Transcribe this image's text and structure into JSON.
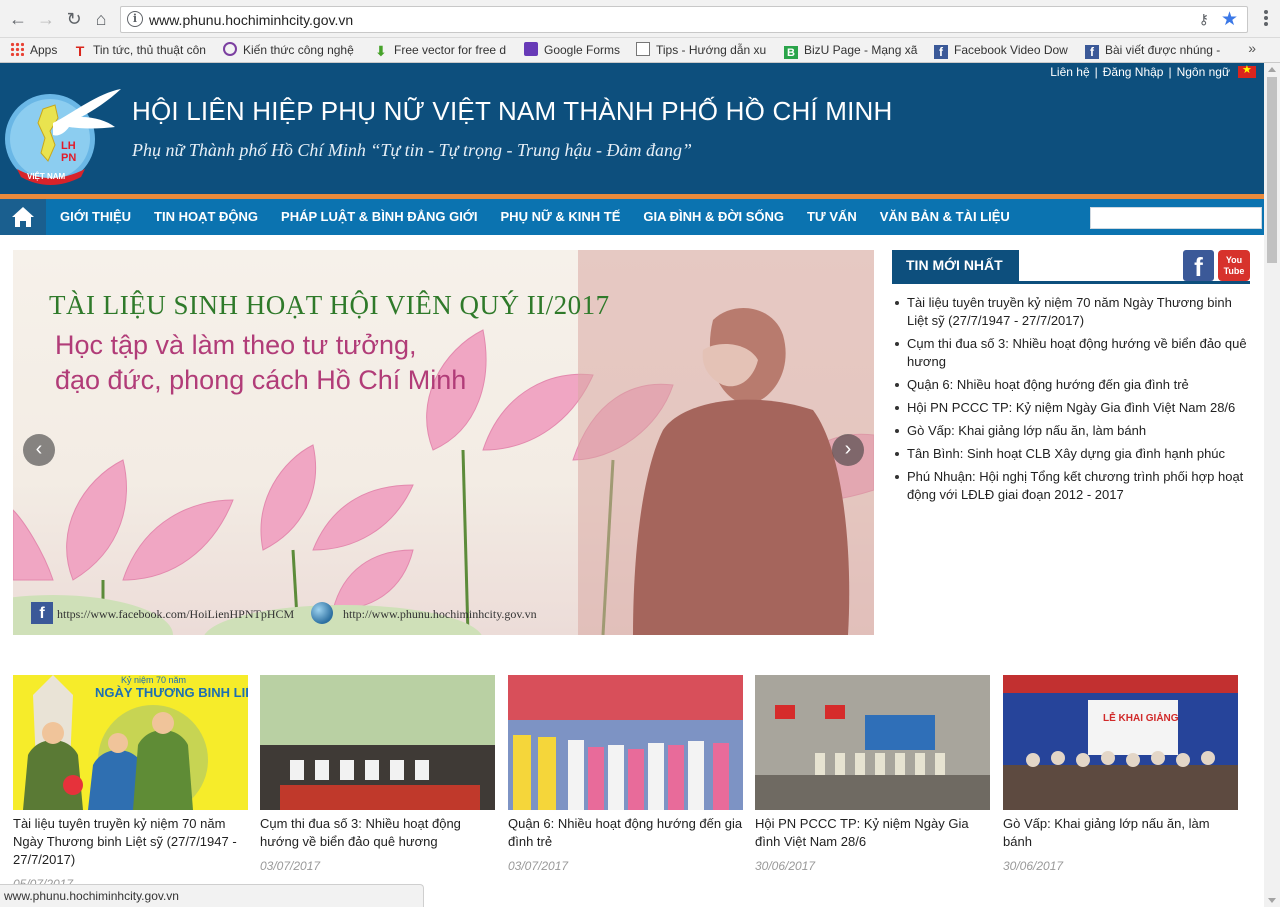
{
  "browser": {
    "url": "www.phunu.hochiminhcity.gov.vn",
    "bookmarks": [
      {
        "label": "Apps",
        "icon": "apps-grid-icon"
      },
      {
        "label": "Tin tức, thủ thuật côn",
        "icon": "t-favicon"
      },
      {
        "label": "Kiến thức công nghệ",
        "icon": "at-favicon"
      },
      {
        "label": "Free vector for free d",
        "icon": "download-arrow-favicon"
      },
      {
        "label": "Google Forms",
        "icon": "forms-favicon"
      },
      {
        "label": "Tips - Hướng dẫn xu",
        "icon": "doc-favicon"
      },
      {
        "label": "BizU Page - Mạng xã",
        "icon": "bizu-favicon"
      },
      {
        "label": "Facebook Video Dow",
        "icon": "facebook-favicon"
      },
      {
        "label": "Bài viết được nhúng -",
        "icon": "facebook-favicon"
      }
    ],
    "more": "»",
    "status_url": "www.phunu.hochiminhcity.gov.vn"
  },
  "header": {
    "title": "HỘI LIÊN HIỆP PHỤ NỮ VIỆT NAM THÀNH PHỐ HỒ CHÍ MINH",
    "slogan": "Phụ nữ Thành phố Hồ Chí Minh “Tự tin - Tự trọng - Trung hậu - Đảm đang”",
    "toplinks": {
      "contact": "Liên hệ",
      "login": "Đăng Nhập",
      "language": "Ngôn ngữ",
      "sep": "|"
    },
    "logo": {
      "lhpn": "LH\nPN",
      "vietnam": "VIỆT NAM"
    },
    "colors": {
      "header_bg": "#0d4f7d",
      "nav_bg": "#0b73b0",
      "accent": "#e98a3c"
    }
  },
  "nav": {
    "items": [
      "GIỚI THIỆU",
      "TIN HOẠT ĐỘNG",
      "PHÁP LUẬT & BÌNH ĐẲNG GIỚI",
      "PHỤ NỮ & KINH TẾ",
      "GIA ĐÌNH & ĐỜI SỐNG",
      "TƯ VẤN",
      "VĂN BẢN & TÀI LIỆU"
    ]
  },
  "slider": {
    "title": "TÀI LIỆU SINH HOẠT HỘI VIÊN QUÝ II/2017",
    "line1": "Học tập và làm theo tư tưởng,",
    "line2": "đạo đức, phong cách Hồ Chí Minh",
    "facebook_url": "https://www.facebook.com/HoiLienHPNTpHCM",
    "web_url": "http://www.phunu.hochiminhcity.gov.vn",
    "prev": "‹",
    "next": "›"
  },
  "latest": {
    "heading": "TIN MỚI NHẤT",
    "youtube": "You\nTube",
    "items": [
      "Tài liệu tuyên truyền kỷ niệm 70 năm Ngày Thương binh Liệt sỹ (27/7/1947 - 27/7/2017)",
      "Cụm thi đua số 3: Nhiều hoạt động hướng về biển đảo quê hương",
      "Quận 6: Nhiều hoạt động hướng đến gia đình trẻ",
      "Hội PN PCCC TP: Kỷ niệm Ngày Gia đình Việt Nam 28/6",
      "Gò Vấp: Khai giảng lớp nấu ăn, làm bánh",
      "Tân Bình: Sinh hoạt CLB Xây dựng gia đình hạnh phúc",
      "Phú Nhuận: Hội nghị Tổng kết chương trình phối hợp hoạt động với LĐLĐ giai đoạn 2012 - 2017"
    ]
  },
  "cards": [
    {
      "title": "Tài liệu tuyên truyền kỷ niệm 70 năm Ngày Thương binh Liệt sỹ (27/7/1947 - 27/7/2017)",
      "date": "05/07/2017",
      "banner": "Kỷ niệm 70 năm",
      "banner2": "NGÀY THƯƠNG BINH LIỆT"
    },
    {
      "title": "Cụm thi đua số 3: Nhiều hoạt động hướng về biển đảo quê hương",
      "date": "03/07/2017"
    },
    {
      "title": "Quận 6: Nhiều hoạt động hướng đến gia đình trẻ",
      "date": "03/07/2017"
    },
    {
      "title": "Hội PN PCCC TP: Kỷ niệm Ngày Gia đình Việt Nam 28/6",
      "date": "30/06/2017"
    },
    {
      "title": "Gò Vấp: Khai giảng lớp nấu ăn, làm bánh",
      "date": "30/06/2017",
      "banner": "LỄ KHAI GIẢNG"
    }
  ]
}
